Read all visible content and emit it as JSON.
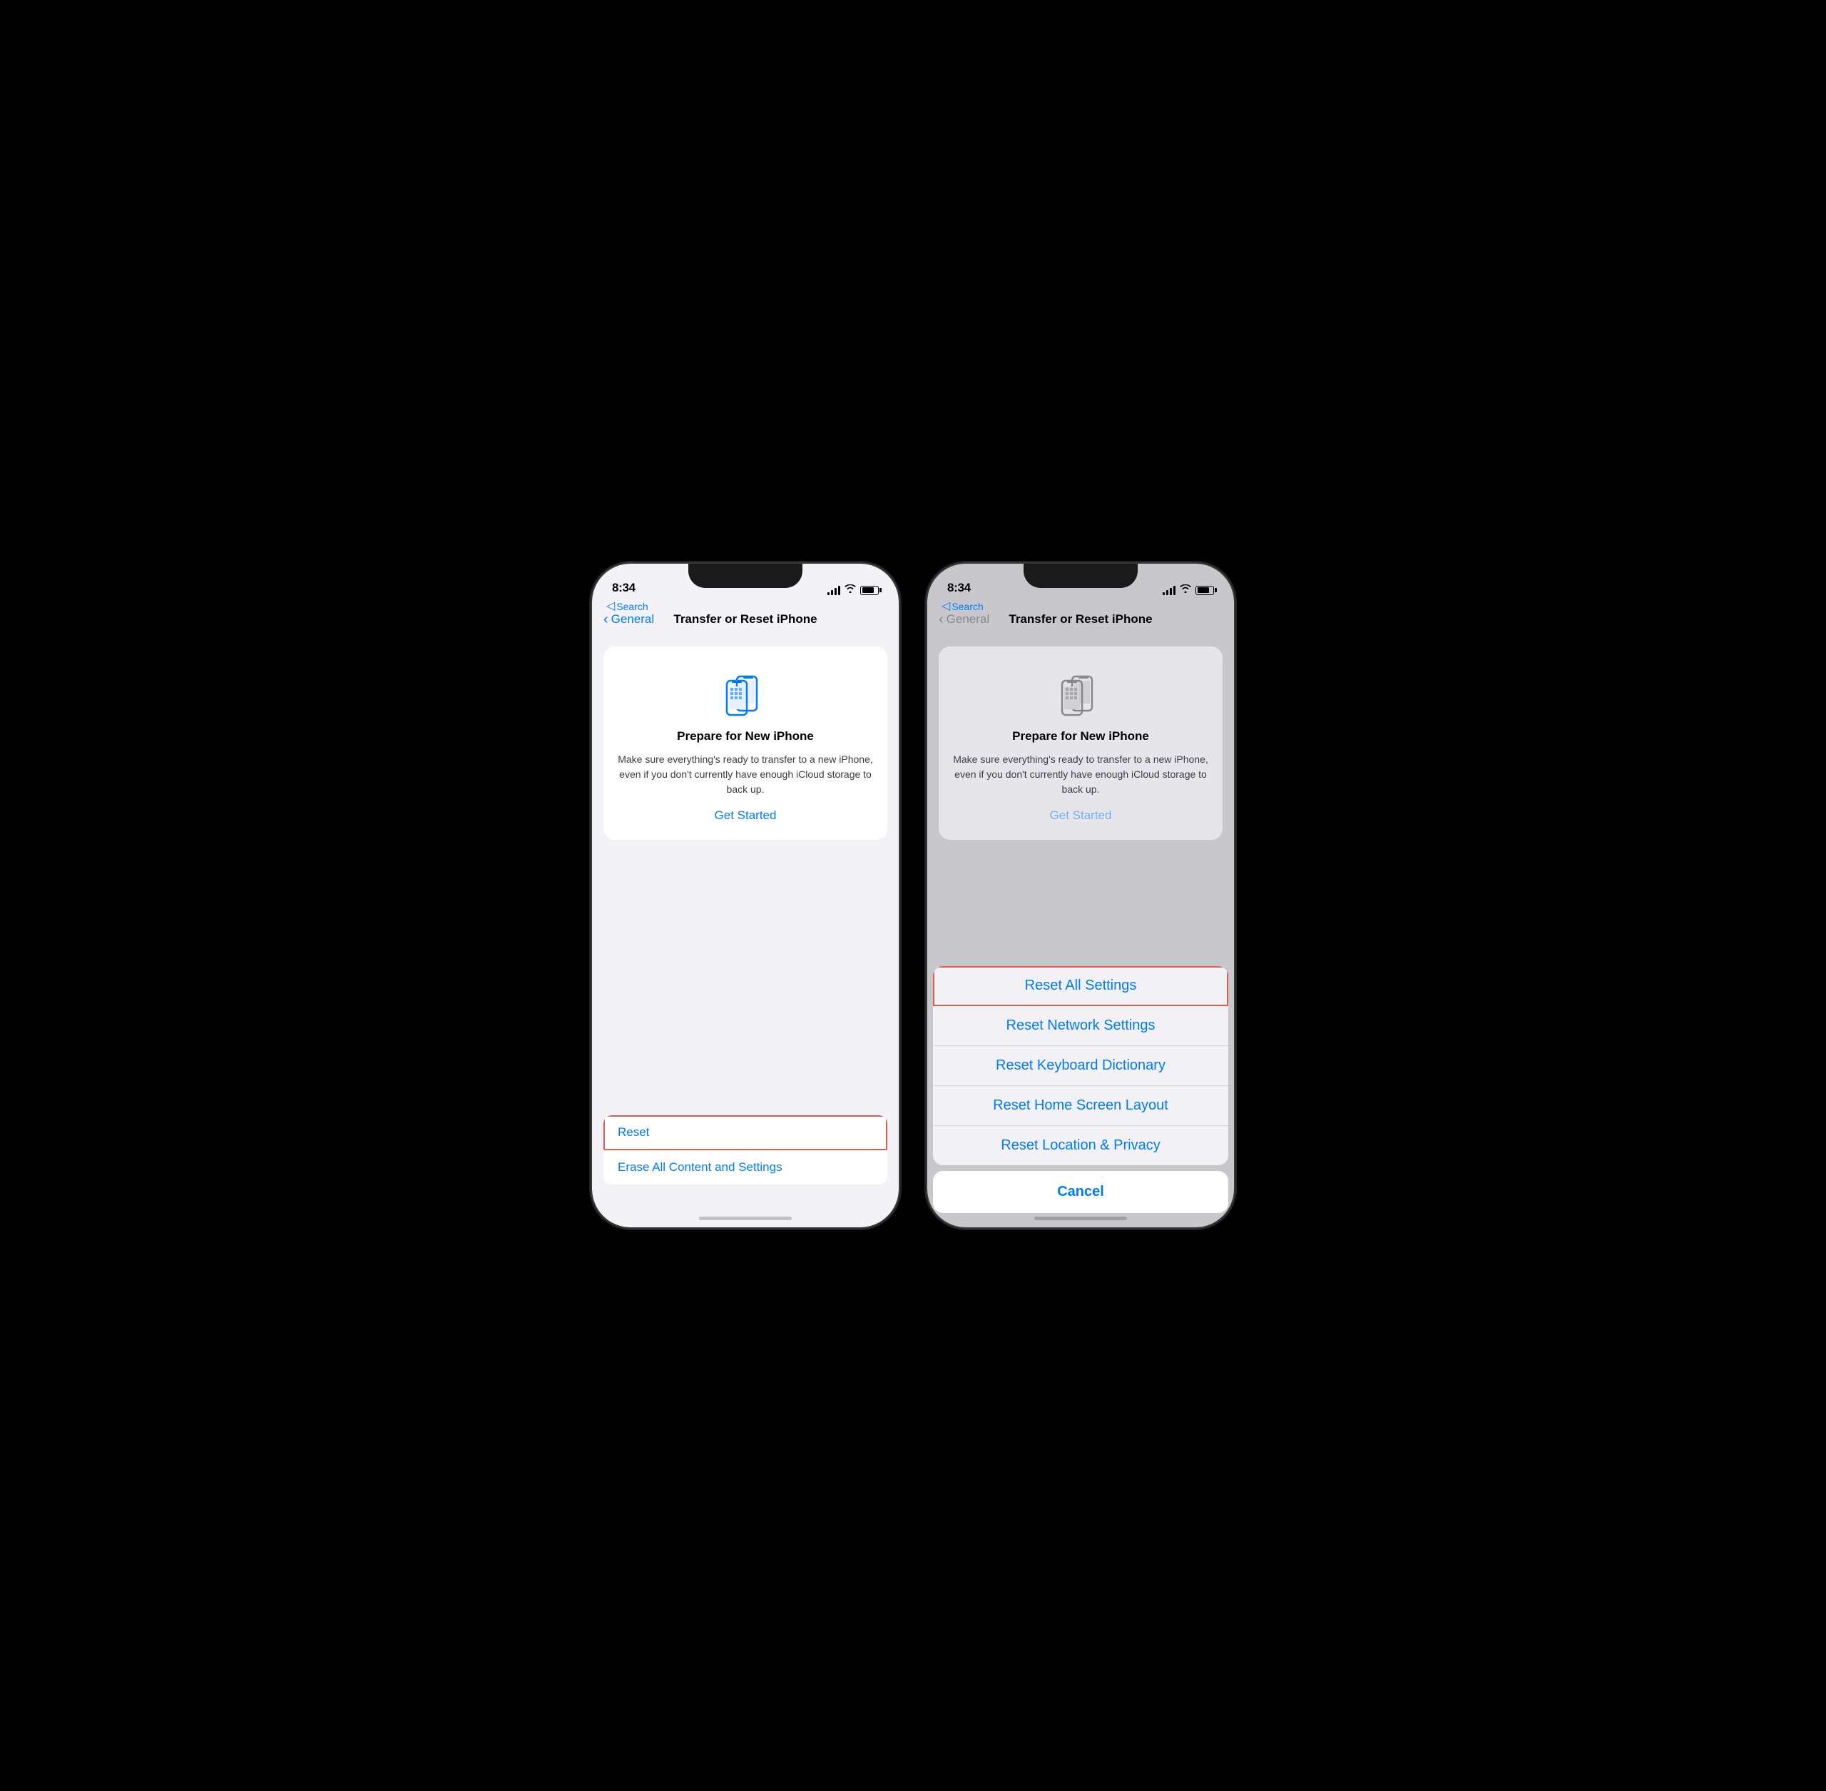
{
  "phone1": {
    "time": "8:34",
    "search_back": "Search",
    "nav_back": "General",
    "nav_title": "Transfer or Reset iPhone",
    "card": {
      "title": "Prepare for New iPhone",
      "description": "Make sure everything's ready to transfer to a new iPhone, even if you don't currently have enough iCloud storage to back up.",
      "link": "Get Started"
    },
    "bottom_items": [
      {
        "label": "Reset",
        "highlighted": true
      },
      {
        "label": "Erase All Content and Settings",
        "highlighted": false
      }
    ]
  },
  "phone2": {
    "time": "8:34",
    "search_back": "Search",
    "nav_back": "General",
    "nav_title": "Transfer or Reset iPhone",
    "card": {
      "title": "Prepare for New iPhone",
      "description": "Make sure everything's ready to transfer to a new iPhone, even if you don't currently have enough iCloud storage to back up.",
      "link": "Get Started"
    },
    "action_items": [
      {
        "label": "Reset All Settings",
        "highlighted": true
      },
      {
        "label": "Reset Network Settings",
        "highlighted": false
      },
      {
        "label": "Reset Keyboard Dictionary",
        "highlighted": false
      },
      {
        "label": "Reset Home Screen Layout",
        "highlighted": false
      },
      {
        "label": "Reset Location & Privacy",
        "highlighted": false
      }
    ],
    "cancel_label": "Cancel"
  },
  "colors": {
    "blue": "#007aff",
    "red_outline": "#e05a4e",
    "text_primary": "#000000",
    "text_secondary": "#3c3c43",
    "separator": "#e5e5ea"
  }
}
